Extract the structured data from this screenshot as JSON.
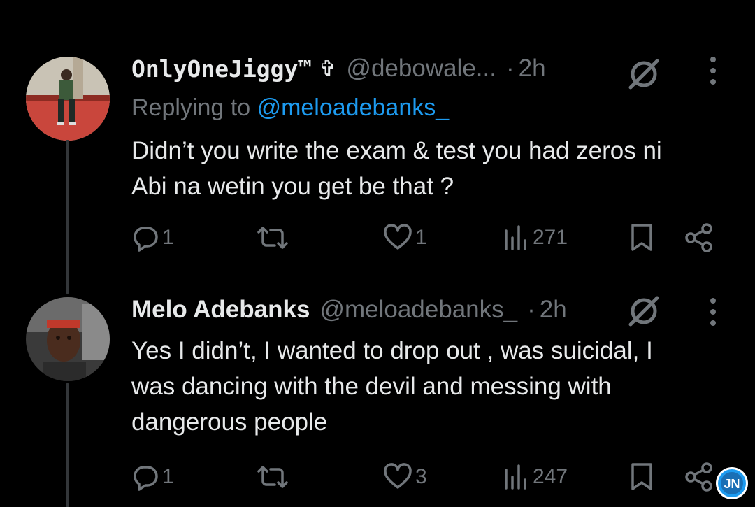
{
  "tweets": [
    {
      "display_name": "OnlyOneJiggy™",
      "badge": "✞",
      "handle": "@debowale...",
      "dot": "·",
      "time": "2h",
      "replying_prefix": "Replying to",
      "replying_mention": "@meloadebanks_",
      "body_lines": [
        "Didn’t you write the exam & test you had zeros ni",
        "Abi na wetin you get be that ?"
      ],
      "replies": "1",
      "retweets": "",
      "likes": "1",
      "views": "271"
    },
    {
      "display_name": "Melo Adebanks",
      "handle": "@meloadebanks_",
      "dot": "·",
      "time": "2h",
      "body_lines": [
        "Yes I didn’t, I wanted to drop out , was suicidal, I",
        "was dancing with the devil and messing with",
        "dangerous people"
      ],
      "replies": "1",
      "retweets": "",
      "likes": "3",
      "views": "247"
    }
  ],
  "watermark_text": "JN",
  "colors": {
    "background": "#000000",
    "text": "#e7e9ea",
    "muted": "#71767b",
    "link": "#1d9bf0",
    "thread_line": "#333639",
    "watermark": "#1d9bf0"
  },
  "icons": [
    "reply-icon",
    "retweet-icon",
    "like-icon",
    "views-icon",
    "bookmark-icon",
    "share-icon",
    "grok-icon",
    "more-icon"
  ]
}
